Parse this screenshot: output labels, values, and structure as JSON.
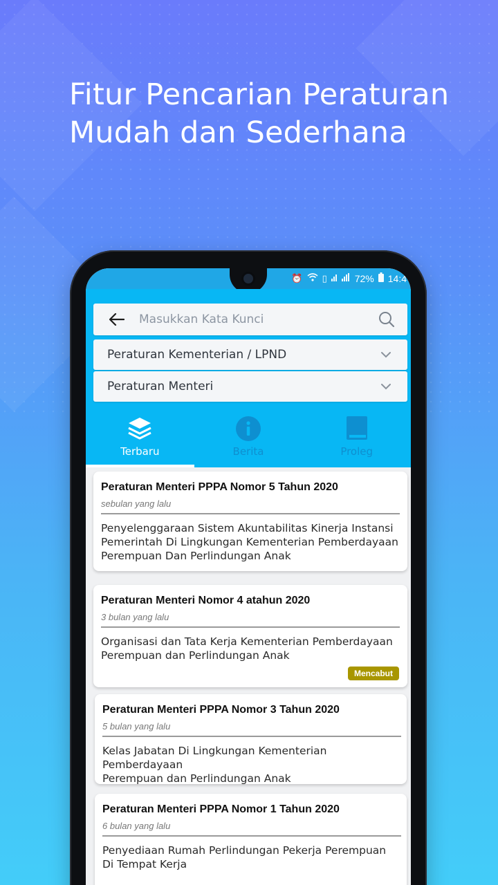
{
  "headline": {
    "line1": "Fitur Pencarian Peraturan",
    "line2": "Mudah dan Sederhana"
  },
  "status_bar": {
    "battery": "72%",
    "time": "14:4"
  },
  "search": {
    "placeholder": "Masukkan Kata Kunci"
  },
  "filters": {
    "category": "Peraturan Kementerian / LPND",
    "type": "Peraturan Menteri"
  },
  "tabs": [
    {
      "label": "Terbaru",
      "icon": "layers-icon",
      "active": true
    },
    {
      "label": "Berita",
      "icon": "info-icon",
      "active": false
    },
    {
      "label": "Proleg",
      "icon": "book-icon",
      "active": false
    }
  ],
  "colors": {
    "app_primary": "#08b7f4",
    "status_bar": "#20a7e6",
    "badge": "#a89600"
  },
  "results": [
    {
      "title": "Peraturan Menteri PPPA Nomor 5 Tahun 2020",
      "time": "sebulan yang lalu",
      "body": "Penyelenggaraan Sistem Akuntabilitas Kinerja Instansi\nPemerintah Di Lingkungan Kementerian Pemberdayaan\nPerempuan Dan Perlindungan Anak"
    },
    {
      "title": "Peraturan Menteri Nomor 4 atahun 2020",
      "time": "3 bulan yang lalu",
      "body": "Organisasi dan Tata Kerja Kementerian Pemberdayaan\nPerempuan dan Perlindungan Anak",
      "badge": "Mencabut"
    },
    {
      "title": "Peraturan Menteri PPPA Nomor 3 Tahun 2020",
      "time": "5 bulan yang lalu",
      "body": "Kelas Jabatan Di Lingkungan Kementerian Pemberdayaan\nPerempuan dan Perlindungan Anak"
    },
    {
      "title": "Peraturan Menteri PPPA Nomor 1 Tahun 2020",
      "time": "6 bulan yang lalu",
      "body": "Penyediaan Rumah Perlindungan Pekerja Perempuan\nDi Tempat Kerja"
    }
  ]
}
